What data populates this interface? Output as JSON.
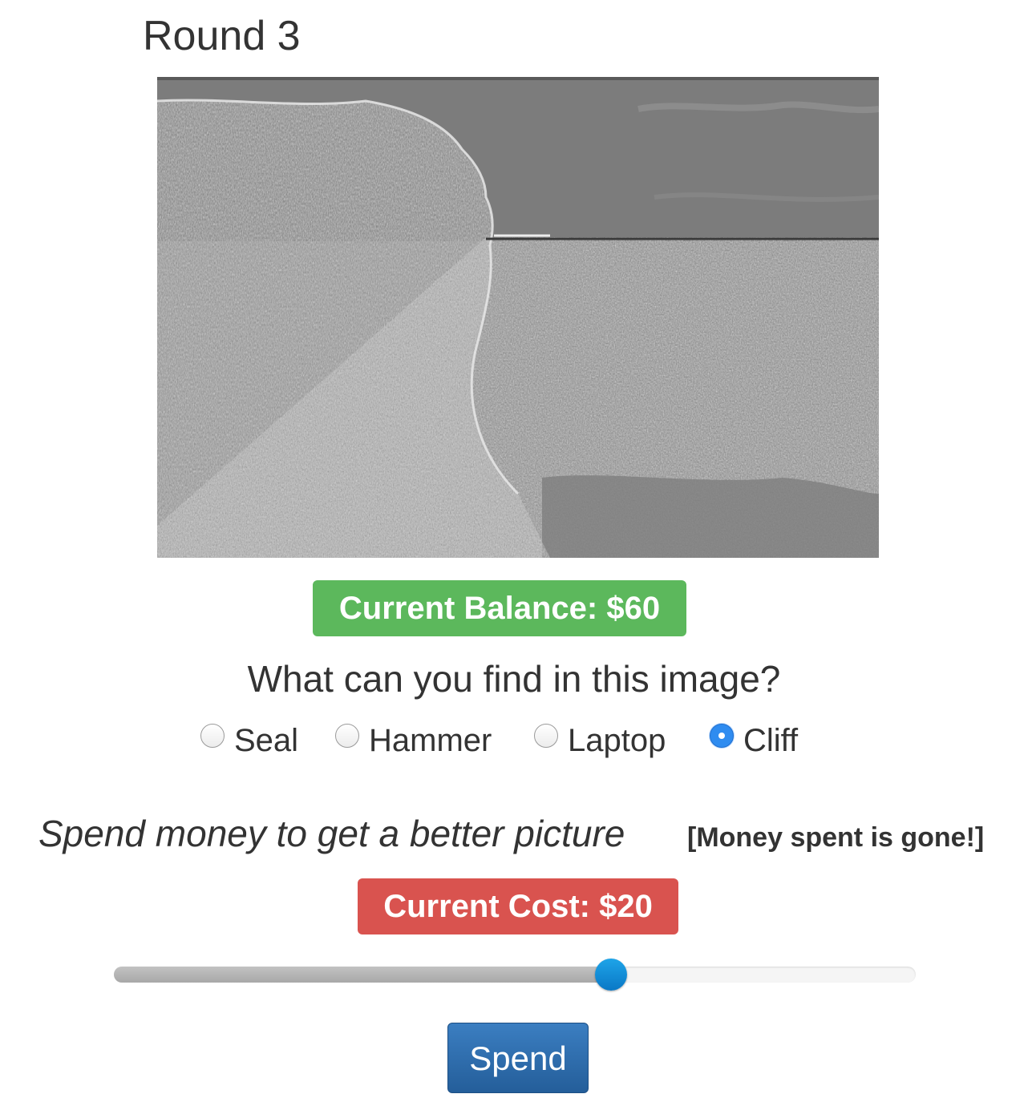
{
  "round": {
    "title": "Round 3"
  },
  "stimulus": {
    "description_icon": "degraded-photo"
  },
  "balance": {
    "label": "Current Balance: $60",
    "color": "#5cb85c"
  },
  "question": {
    "text": "What can you find in this image?",
    "options": [
      {
        "label": "Seal",
        "checked": false
      },
      {
        "label": "Hammer",
        "checked": false
      },
      {
        "label": "Laptop",
        "checked": false
      },
      {
        "label": "Cliff",
        "checked": true
      }
    ]
  },
  "spend": {
    "prompt": "Spend money to get a better picture",
    "warning": "[Money spent is gone!]",
    "cost_label": "Current Cost: $20",
    "cost_color": "#d9534f",
    "slider_fraction": 0.62,
    "button_label": "Spend",
    "button_color": "#2f6fae"
  }
}
